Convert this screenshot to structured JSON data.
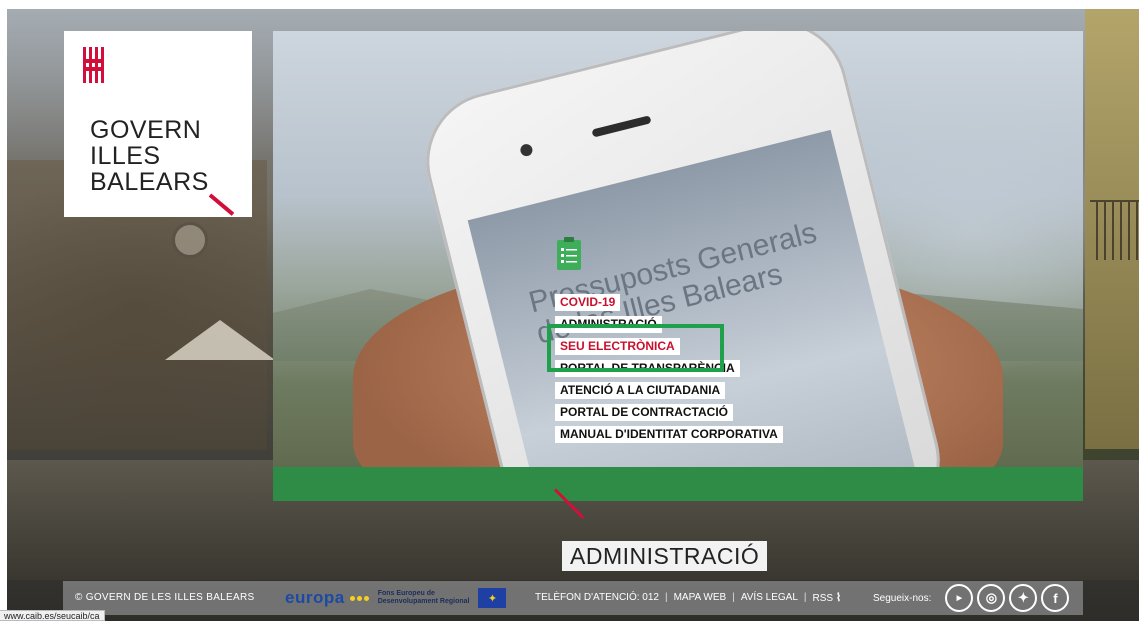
{
  "logo": {
    "text": "GOVERN\nILLES\nBALEARS",
    "icon": "govern-illes-balears-emblem",
    "accent_color": "#d0103a"
  },
  "hero": {
    "phone_screen_title": "Pressuposts Generals de les Illes Balears",
    "bar_color": "#2e8c46"
  },
  "menu": {
    "icon": "document-list-icon",
    "items": [
      {
        "label": "COVID-19",
        "accent": true
      },
      {
        "label": "ADMINISTRACIÓ",
        "accent": false
      },
      {
        "label": "SEU ELECTRÒNICA",
        "accent": true
      },
      {
        "label": "PORTAL DE TRANSPARÈNCIA",
        "accent": false
      },
      {
        "label": "ATENCIÓ A LA CIUTADANIA",
        "accent": false
      },
      {
        "label": "PORTAL DE CONTRACTACIÓ",
        "accent": false
      },
      {
        "label": "MANUAL D'IDENTITAT CORPORATIVA",
        "accent": false
      }
    ],
    "highlight_color": "#1fa14c"
  },
  "section_label": "ADMINISTRACIÓ",
  "footer": {
    "copyright": "© GOVERN DE LES ILLES BALEARS",
    "europa_word": "europa",
    "fund_line1": "Fons Europeu de",
    "fund_line2": "Desenvolupament Regional",
    "phone": "TELÈFON D'ATENCIÓ: 012",
    "map": "MAPA WEB",
    "legal": "AVÍS LEGAL",
    "rss": "RSS",
    "follow": "Segueix-nos:",
    "social": [
      {
        "label": "You Tube",
        "icon": "youtube-icon"
      },
      {
        "label": "◎",
        "icon": "instagram-icon"
      },
      {
        "label": "🐦",
        "icon": "twitter-icon"
      },
      {
        "label": "f",
        "icon": "facebook-icon"
      }
    ]
  },
  "status_bar": {
    "url": "www.caib.es/seucaib/ca"
  }
}
